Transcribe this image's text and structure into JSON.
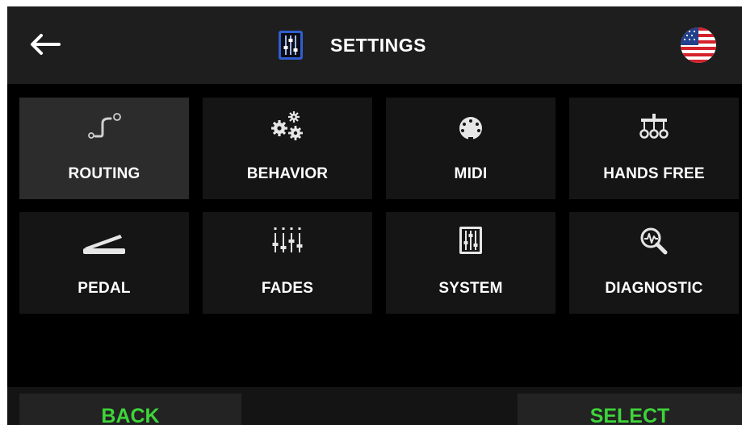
{
  "header": {
    "title": "SETTINGS",
    "back_icon": "back-arrow-icon",
    "title_icon": "system-sliders-icon",
    "language_icon": "us-flag-icon"
  },
  "tiles": [
    {
      "label": "ROUTING",
      "icon": "routing-icon",
      "selected": true
    },
    {
      "label": "BEHAVIOR",
      "icon": "gears-icon",
      "selected": false
    },
    {
      "label": "MIDI",
      "icon": "midi-connector-icon",
      "selected": false
    },
    {
      "label": "HANDS FREE",
      "icon": "hands-free-pedal-icon",
      "selected": false
    },
    {
      "label": "PEDAL",
      "icon": "expression-pedal-icon",
      "selected": false
    },
    {
      "label": "FADES",
      "icon": "faders-icon",
      "selected": false
    },
    {
      "label": "SYSTEM",
      "icon": "system-sliders-icon",
      "selected": false
    },
    {
      "label": "DIAGNOSTIC",
      "icon": "diagnostic-magnifier-icon",
      "selected": false
    }
  ],
  "footer": {
    "back_label": "BACK",
    "select_label": "SELECT"
  },
  "colors": {
    "accent_green": "#3ed43a",
    "title_icon_blue": "#2f5fd0",
    "tile_bg": "#151515",
    "tile_selected_bg": "#2c2c2c",
    "header_bg": "#1e1e1e"
  }
}
